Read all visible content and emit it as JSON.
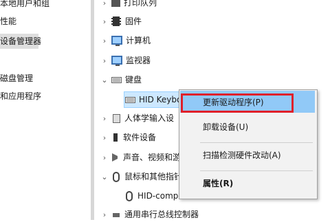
{
  "left_pane": {
    "items": [
      {
        "label": "本地用户和组"
      },
      {
        "label": "性能"
      },
      {
        "label": "设备管理器"
      },
      {
        "label": "磁盘管理"
      },
      {
        "label": "和应用程序"
      }
    ]
  },
  "tree": {
    "rows": [
      {
        "label": "打印队列",
        "icon": "printer-icon"
      },
      {
        "label": "固件",
        "icon": "firmware-icon"
      },
      {
        "label": "计算机",
        "icon": "computer-icon"
      },
      {
        "label": "监视器",
        "icon": "monitor-icon"
      },
      {
        "label": "键盘",
        "icon": "keyboard-icon"
      },
      {
        "label": "HID Keybo",
        "icon": "keyboard-device-icon"
      },
      {
        "label": "人体学输入设",
        "icon": "hid-icon"
      },
      {
        "label": "软件设备",
        "icon": "software-device-icon"
      },
      {
        "label": "声音、视频和游",
        "icon": "sound-icon"
      },
      {
        "label": "鼠标和其他指针",
        "icon": "mouse-icon"
      },
      {
        "label": "HID-compliant mouse",
        "icon": "mouse-device-icon"
      },
      {
        "label": "通用串行总线控制器",
        "icon": "usb-icon"
      }
    ]
  },
  "context_menu": {
    "items": [
      {
        "label": "更新驱动程序(P)"
      },
      {
        "label": "卸载设备(U)"
      },
      {
        "label": "扫描检测硬件改动(A)"
      },
      {
        "label": "属性(R)"
      }
    ],
    "highlight_color": "#91c9f7",
    "annotation_color": "#e0202a"
  }
}
